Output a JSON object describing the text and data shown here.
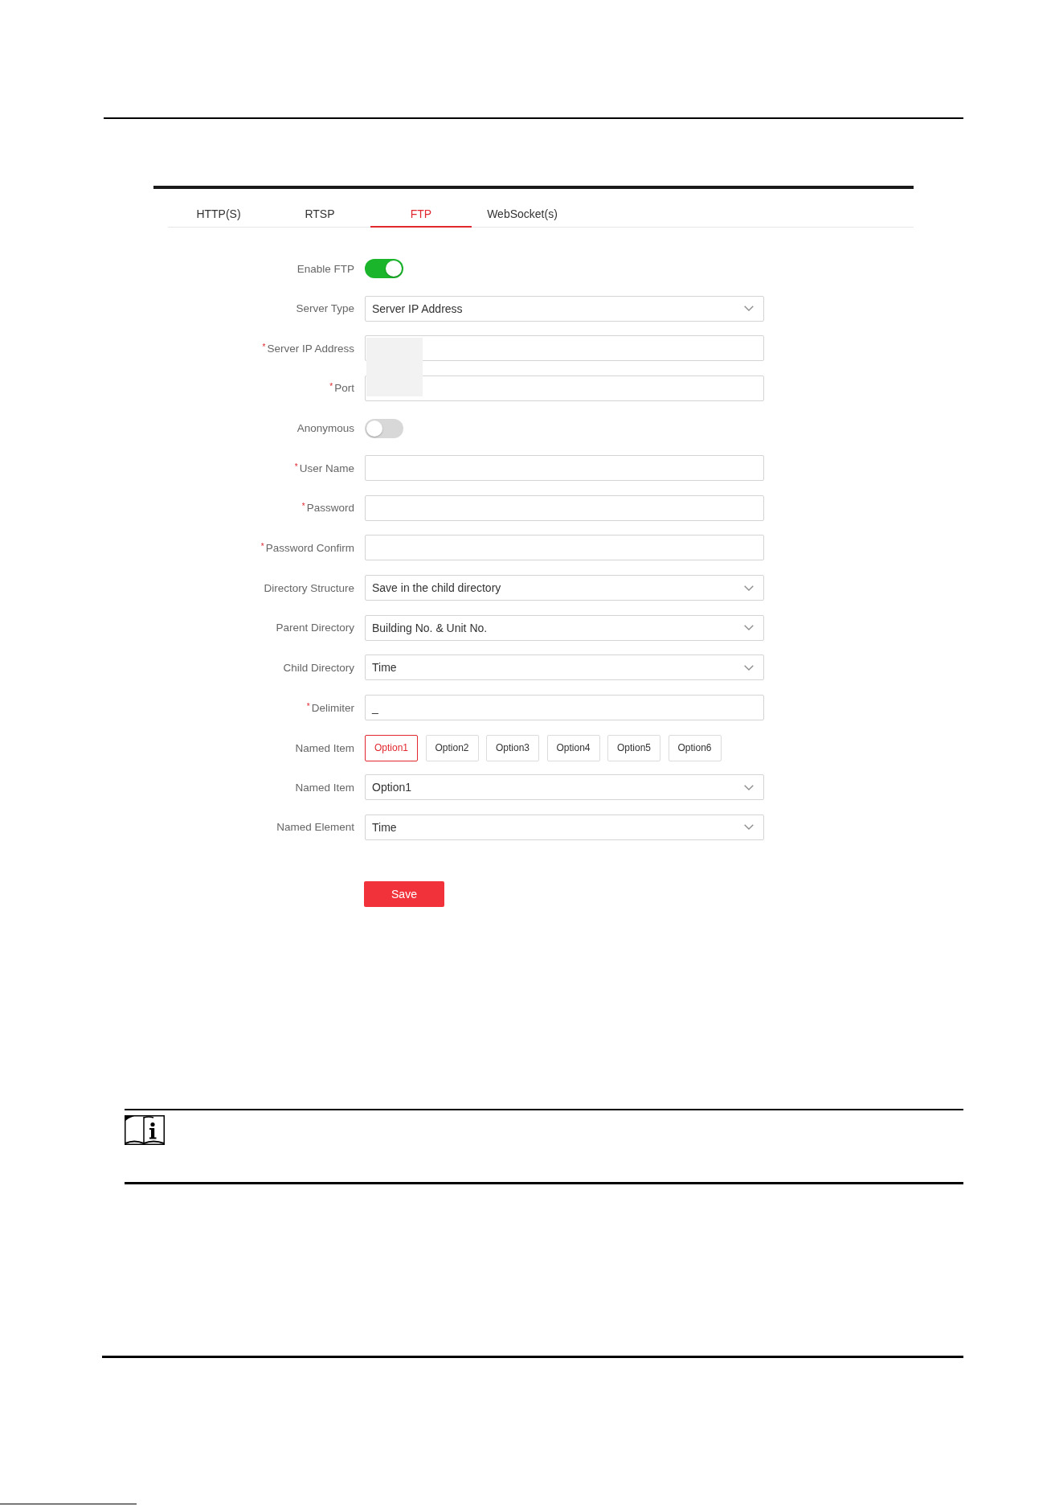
{
  "tabs": [
    {
      "label": "HTTP(S)",
      "selected": false
    },
    {
      "label": "RTSP",
      "selected": false
    },
    {
      "label": "FTP",
      "selected": true
    },
    {
      "label": "WebSocket(s)",
      "selected": false
    }
  ],
  "form": {
    "rows": [
      {
        "kind": "toggle",
        "label": "Enable FTP",
        "on": true
      },
      {
        "kind": "select",
        "label": "Server Type",
        "value": "Server IP Address"
      },
      {
        "kind": "input",
        "label": "Server IP Address",
        "required_mark": "*",
        "redacted": true
      },
      {
        "kind": "input",
        "label": "Port",
        "required_mark": "*",
        "redacted": true
      },
      {
        "kind": "toggle",
        "label": "Anonymous",
        "on": false
      },
      {
        "kind": "input",
        "label": "User Name",
        "required_mark": "*"
      },
      {
        "kind": "input",
        "label": "Password",
        "required_mark": "*"
      },
      {
        "kind": "input",
        "label": "Password Confirm",
        "required_mark": "*"
      },
      {
        "kind": "select",
        "label": "Directory Structure",
        "value": "Save in the child directory"
      },
      {
        "kind": "select",
        "label": "Parent Directory",
        "value": "Building No. & Unit No."
      },
      {
        "kind": "select",
        "label": "Child Directory",
        "value": "Time"
      },
      {
        "kind": "input",
        "label": "Delimiter",
        "required_mark": "*",
        "value": "_"
      },
      {
        "kind": "options",
        "label": "Named Item",
        "options": [
          {
            "label": "Option1",
            "selected": true
          },
          {
            "label": "Option2",
            "selected": false
          },
          {
            "label": "Option3",
            "selected": false
          },
          {
            "label": "Option4",
            "selected": false
          },
          {
            "label": "Option5",
            "selected": false
          },
          {
            "label": "Option6",
            "selected": false
          }
        ]
      },
      {
        "kind": "select",
        "label": "Named Item",
        "value": "Option1"
      },
      {
        "kind": "select",
        "label": "Named Element",
        "value": "Time"
      }
    ],
    "save_button": "Save"
  }
}
